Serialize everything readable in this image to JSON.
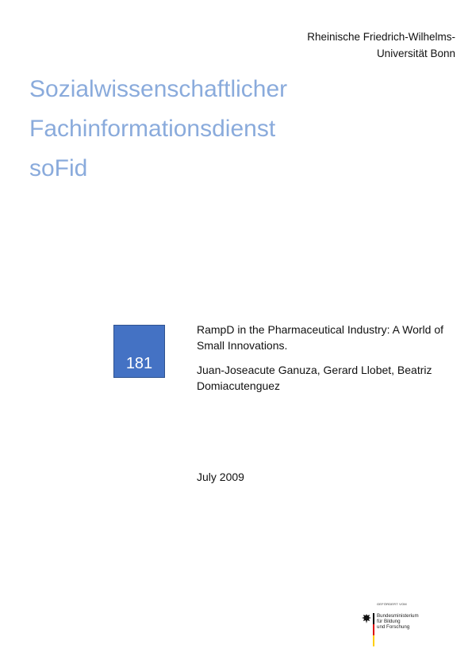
{
  "university": {
    "line1": "Rheinische Friedrich-Wilhelms-",
    "line2": "Universität Bonn"
  },
  "title": {
    "line1": "Sozialwissenschaftlicher",
    "line2": "Fachinformationsdienst",
    "line3": "soFid"
  },
  "issue_number": "181",
  "publication": {
    "title": "RampD in the Pharmaceutical Industry: A World of Small Innovations.",
    "authors": "Juan-Joseacute Ganuza, Gerard Llobet, Beatriz Domiacutenguez"
  },
  "date": "July 2009",
  "funder": {
    "label": "GEFÖRDERT VOM",
    "line1": "Bundesministerium",
    "line2": "für Bildung",
    "line3": "und Forschung",
    "flag_colors": [
      "#000000",
      "#dd0000",
      "#ffce00"
    ]
  },
  "colors": {
    "title": "#8aabdc",
    "badge": "#4472c4"
  }
}
